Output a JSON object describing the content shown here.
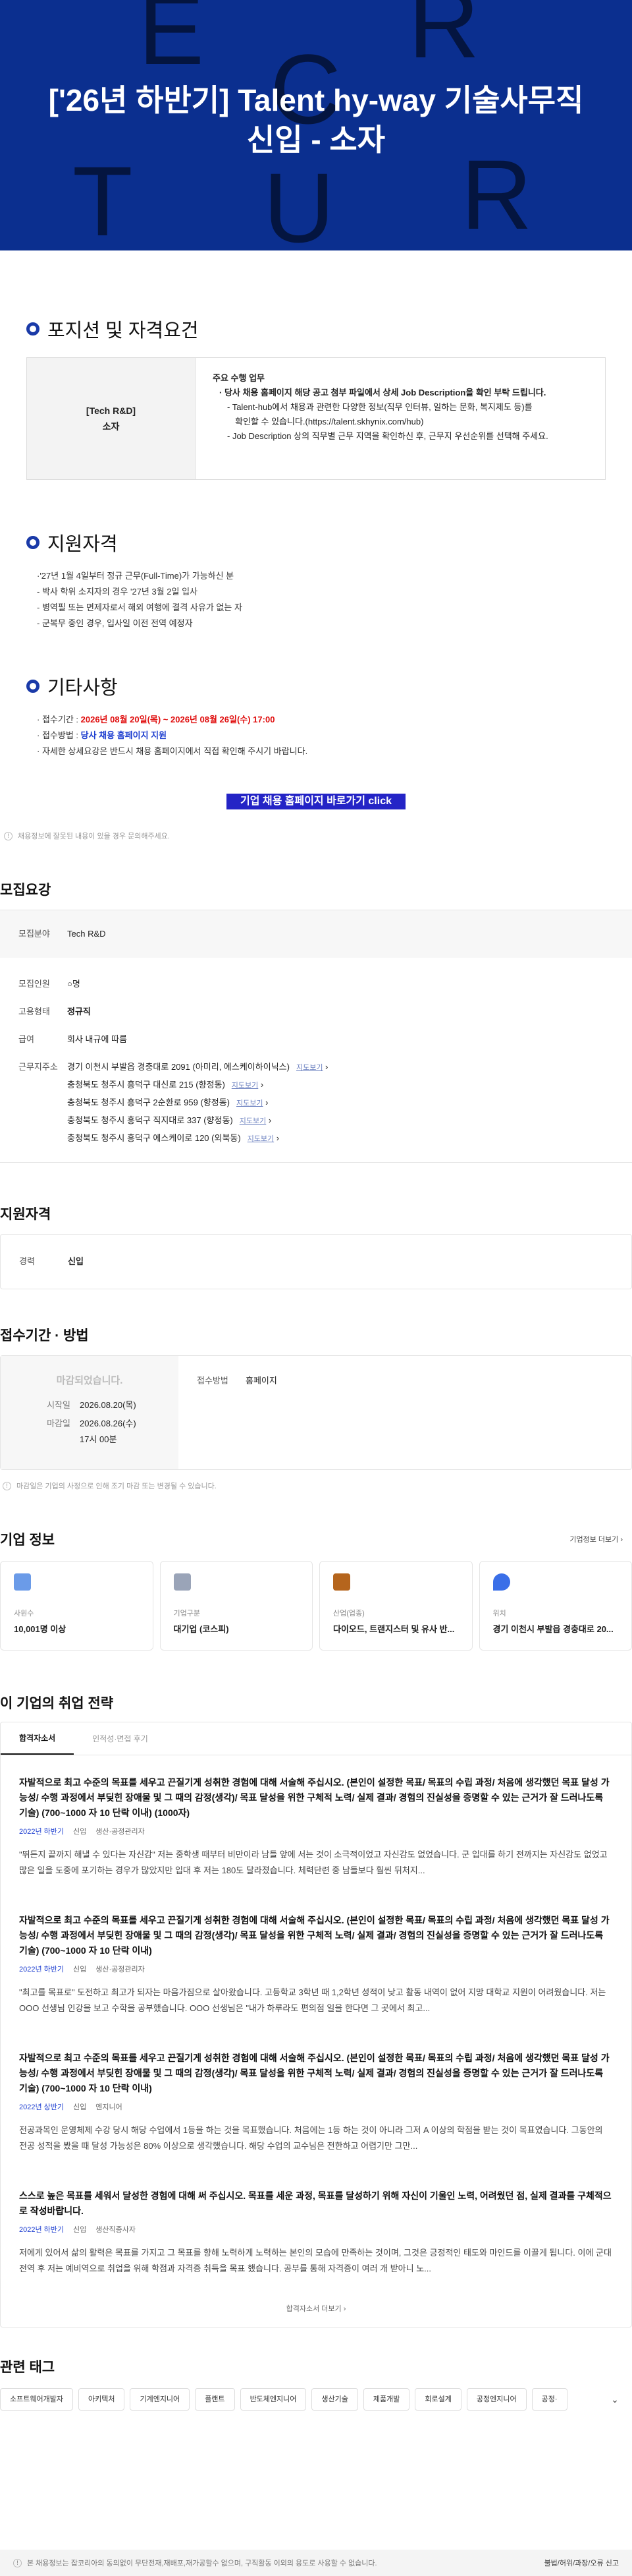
{
  "banner": {
    "title_line1": "['26년 하반기] Talent hy-way 기술사무직",
    "title_line2": "신입 - 소자",
    "letters": [
      "E",
      "R",
      "C",
      "T",
      "U",
      "R"
    ]
  },
  "position": {
    "section_title": "포지션 및 자격요건",
    "dept": "[Tech R&D]",
    "role": "소자",
    "duties_title": "주요 수행 업무",
    "duty1": "· 당사 채용 홈페이지 해당 공고 첨부 파일에서 상세 Job Description을 확인 부탁 드립니다.",
    "duty2a": "- Talent-hub에서 채용과 관련한 다양한 정보(직무 인터뷰, 일하는 문화, 복지제도 등)를",
    "duty2b": "확인할 수 있습니다.(https://talent.skhynix.com/hub)",
    "duty3": "- Job Description 상의 직무별 근무 지역을 확인하신 후, 근무지 우선순위를 선택해 주세요."
  },
  "qualification": {
    "section_title": "지원자격",
    "items": [
      "·'27년 1월 4일부터 정규 근무(Full-Time)가 가능하신 분",
      "- 박사 학위 소지자의 경우 '27년 3월 2일 입사",
      "- 병역필 또는 면제자로서 해외 여행에 결격 사유가 없는 자",
      "- 군복무 중인 경우, 입사일 이전 전역 예정자"
    ]
  },
  "etc": {
    "section_title": "기타사항",
    "period_label": "· 접수기간 : ",
    "period_value": "2026년 08월 20일(목) ~ 2026년 08월 26일(수) 17:00",
    "method_label": "· 접수방법 : ",
    "method_value": "당사 채용 홈페이지 지원",
    "detail": "· 자세한 상세요강은 반드시 채용 홈페이지에서 직접 확인해 주시기 바랍니다.",
    "cta": "기업 채용 홈페이지 바로가기 click"
  },
  "edit_note": "채용정보에 잘못된 내용이 있을 경우 문의해주세요.",
  "summary": {
    "title": "모집요강",
    "field_label": "모집분야",
    "field_value": "Tech R&D",
    "count_label": "모집인원",
    "count_value": "○명",
    "type_label": "고용형태",
    "type_value": "정규직",
    "salary_label": "급여",
    "salary_value": "회사 내규에 따름",
    "location_label": "근무지주소",
    "map_label": "지도보기",
    "locations": [
      "경기 이천시 부발읍 경충대로 2091 (아미리, 에스케이하이닉스)",
      "충청북도 청주시 흥덕구 대신로 215 (향정동)",
      "충청북도 청주시 흥덕구 2순환로 959 (향정동)",
      "충청북도 청주시 흥덕구 직지대로 337 (향정동)",
      "충청북도 청주시 흥덕구 에스케이로 120 (외북동)"
    ]
  },
  "apply_qual": {
    "title": "지원자격",
    "career_label": "경력",
    "career_value": "신입"
  },
  "period": {
    "title": "접수기간 · 방법",
    "closed": "마감되었습니다.",
    "start_label": "시작일",
    "start_value": "2026.08.20(목)",
    "end_label": "마감일",
    "end_value": "2026.08.26(수)",
    "end_time": "17시 00분",
    "method_label": "접수방법",
    "method_value": "홈페이지",
    "note": "마감일은 기업의 사정으로 인해 조기 마감 또는 변경될 수 있습니다."
  },
  "company": {
    "title": "기업 정보",
    "more": "기업정보 더보기",
    "cards": [
      {
        "label": "사원수",
        "value": "10,001명 이상",
        "icon": "people-icon",
        "color": "#6b9be8"
      },
      {
        "label": "기업구분",
        "value": "대기업 (코스피)",
        "icon": "building-icon",
        "color": "#9aa4b8"
      },
      {
        "label": "산업(업종)",
        "value": "다이오드, 트랜지스터 및 유사 반...",
        "icon": "briefcase-icon",
        "color": "#b5651d"
      },
      {
        "label": "위치",
        "value": "경기 이천시 부발읍 경충대로 20...",
        "icon": "pin-icon",
        "color": "#3a6fe8"
      }
    ]
  },
  "strategy": {
    "title": "이 기업의 취업 전략",
    "tab_active": "합격자소서",
    "tab_other": "인적성·면접 후기",
    "more": "합격자소서 더보기",
    "items": [
      {
        "q": "자발적으로 최고 수준의 목표를 세우고 끈질기게 성취한 경험에 대해 서술해 주십시오. (본인이 설정한 목표/ 목표의 수립 과정/ 처음에 생각했던 목표 달성 가능성/ 수행 과정에서 부딪힌 장애물 및 그 때의 감정(생각)/ 목표 달성을 위한 구체적 노력/ 실제 결과/ 경험의 진실성을 증명할 수 있는 근거가 잘 드러나도록 기술) (700~1000 자 10 단락 이내) (1000자)",
        "year": "2022년 하반기",
        "level": "신입",
        "job": "생산·공정관리자",
        "a": "\"뛰든지 끝까지 해낼 수 있다는 자신감\" 저는 중학생 때부터 비만이라 남들 앞에 서는 것이 소극적이었고 자신감도 없었습니다. 군 입대를 하기 전까지는 자신감도 없었고 많은 일을 도중에 포기하는 경우가 많았지만 입대 후 저는 180도 달라졌습니다. 체력단련 중 남들보다 훨씬 뒤처지..."
      },
      {
        "q": "자발적으로 최고 수준의 목표를 세우고 끈질기게 성취한 경험에 대해 서술해 주십시오. (본인이 설정한 목표/ 목표의 수립 과정/ 처음에 생각했던 목표 달성 가능성/ 수행 과정에서 부딪힌 장애물 및 그 때의 감정(생각)/ 목표 달성을 위한 구체적 노력/ 실제 결과/ 경험의 진실성을 증명할 수 있는 근거가 잘 드러나도록 기술) (700~1000 자 10 단락 이내)",
        "year": "2022년 하반기",
        "level": "신입",
        "job": "생산·공정관리자",
        "a": "\"최고를 목표로\" 도전하고 최고가 되자는 마음가짐으로 살아왔습니다. 고등학교 3학년 때 1,2학년 성적이 낮고 활동 내역이 없어 지망 대학교 지원이 어려웠습니다. 저는 OOO 선생님 인강을 보고 수학을 공부했습니다. OOO 선생님은 \"내가 하루라도 편의점 일을 한다면 그 곳에서 최고..."
      },
      {
        "q": "자발적으로 최고 수준의 목표를 세우고 끈질기게 성취한 경험에 대해 서술해 주십시오. (본인이 설정한 목표/ 목표의 수립 과정/ 처음에 생각했던 목표 달성 가능성/ 수행 과정에서 부딪힌 장애물 및 그 때의 감정(생각)/ 목표 달성을 위한 구체적 노력/ 실제 결과/ 경험의 진실성을 증명할 수 있는 근거가 잘 드러나도록 기술) (700~1000 자 10 단락 이내)",
        "year": "2022년 상반기",
        "level": "신입",
        "job": "엔지니어",
        "a": "전공과목인 운영체제 수강 당시 해당 수업에서 1등을 하는 것을 목표했습니다. 처음에는 1등 하는 것이 아니라 그저 A 이상의 학점을 받는 것이 목표였습니다. 그동안의 전공 성적을 봤을 때 달성 가능성은 80% 이상으로 생각했습니다. 해당 수업의 교수님은 전한하고 어렵기만 그만..."
      },
      {
        "q": "스스로 높은 목표를 세워서 달성한 경험에 대해 써 주십시오. 목표를 세운 과정, 목표를 달성하기 위해 자신이 기울인 노력, 어려웠던 점, 실제 결과를 구체적으로 작성바랍니다.",
        "year": "2022년 하반기",
        "level": "신입",
        "job": "생산직종사자",
        "a": "저에게 있어서 삶의 활력은 목표를 가지고 그 목표를 향해 노력하게 노력하는 본인의 모습에 만족하는 것이며, 그것은 긍정적인 태도와 마인드를 이끌게 됩니다. 이에 군대 전역 후 저는 예비역으로 취업을 위해 학점과 자격증 취득을 목표 했습니다. 공부를 통해 자격증이 여러 개 받아니 노..."
      }
    ]
  },
  "tags": {
    "title": "관련 태그",
    "items": [
      "소프트웨어개발자",
      "아키텍처",
      "기계엔지니어",
      "플랜트",
      "반도체엔지니어",
      "생산기술",
      "제품개발",
      "회로설계",
      "공정엔지니어",
      "공정·"
    ]
  },
  "footer": {
    "text": "본 채용정보는 잡코리아의 동의없이 무단전재,재배포,재가공할수 없으며, 구직활동 이외의 용도로 사용할 수 없습니다.",
    "links": "불법/허위/과장/오류 신고"
  }
}
